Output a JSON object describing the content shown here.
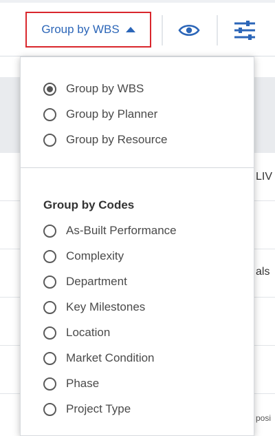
{
  "toolbar": {
    "group_button_label": "Group by WBS",
    "accent_color": "#2c66b8",
    "highlight_color": "#d9262c",
    "icons": [
      "caret-up-icon",
      "eye-icon",
      "sliders-icon"
    ]
  },
  "background_table": {
    "fragments": [
      "LIV",
      "als",
      "posi"
    ]
  },
  "dropdown": {
    "group_options": [
      {
        "label": "Group by WBS",
        "checked": true
      },
      {
        "label": "Group by Planner",
        "checked": false
      },
      {
        "label": "Group by Resource",
        "checked": false
      }
    ],
    "codes_title": "Group by Codes",
    "code_options": [
      {
        "label": "As-Built Performance",
        "checked": false
      },
      {
        "label": "Complexity",
        "checked": false
      },
      {
        "label": "Department",
        "checked": false
      },
      {
        "label": "Key Milestones",
        "checked": false
      },
      {
        "label": "Location",
        "checked": false
      },
      {
        "label": "Market Condition",
        "checked": false
      },
      {
        "label": "Phase",
        "checked": false
      },
      {
        "label": "Project Type",
        "checked": false
      }
    ]
  }
}
